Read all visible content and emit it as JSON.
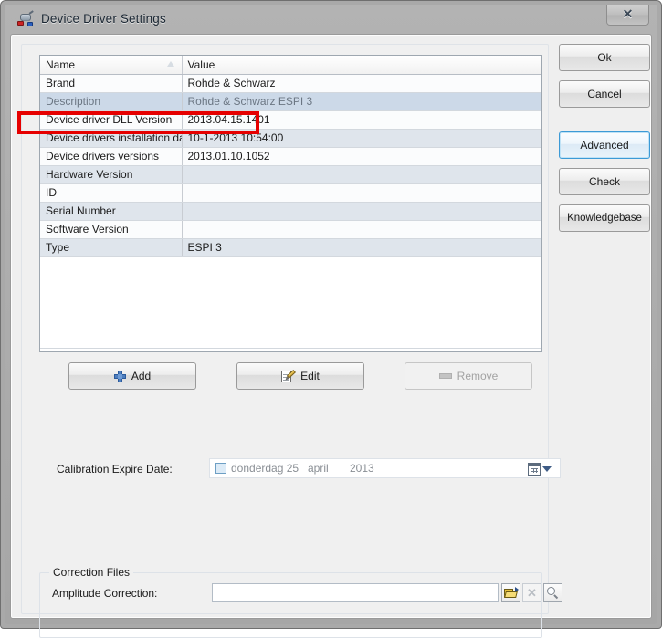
{
  "window": {
    "title": "Device Driver Settings",
    "title_icon": "device-driver-icon",
    "close_label": "✕"
  },
  "grid": {
    "columns": [
      "Name",
      "Value"
    ],
    "sort_indicator": "ascending",
    "rows": [
      {
        "name": "Brand",
        "value": "Rohde & Schwarz",
        "state": "normal"
      },
      {
        "name": "Description",
        "value": "Rohde & Schwarz ESPI 3",
        "state": "selected"
      },
      {
        "name": "Device driver DLL Version",
        "value": "2013.04.15.1401",
        "state": "normal"
      },
      {
        "name": "Device drivers installation date",
        "value": "10-1-2013 10:54:00",
        "state": "alt"
      },
      {
        "name": "Device drivers versions",
        "value": "2013.01.10.1052",
        "state": "normal"
      },
      {
        "name": "Hardware Version",
        "value": "",
        "state": "alt"
      },
      {
        "name": "ID",
        "value": "",
        "state": "normal"
      },
      {
        "name": "Serial Number",
        "value": "",
        "state": "alt"
      },
      {
        "name": "Software Version",
        "value": "",
        "state": "normal"
      },
      {
        "name": "Type",
        "value": "ESPI 3",
        "state": "alt"
      }
    ]
  },
  "row_buttons": {
    "add": "Add",
    "edit": "Edit",
    "remove": "Remove"
  },
  "calibration": {
    "label": "Calibration Expire Date:",
    "checked": false,
    "day": "donderdag 25",
    "month": "april",
    "year": "2013"
  },
  "correction": {
    "legend": "Correction Files",
    "amplitude_label": "Amplitude Correction:",
    "amplitude_value": "",
    "amplitude_placeholder": "",
    "browse_icon": "open-folder-icon",
    "clear_icon": "clear-x-icon",
    "search_icon": "magnifier-icon"
  },
  "side_buttons": {
    "ok": "Ok",
    "cancel": "Cancel",
    "advanced": "Advanced",
    "check": "Check",
    "knowledgebase": "Knowledgebase"
  },
  "annotation": {
    "color": "#e60000",
    "target_row": "Device driver DLL Version"
  }
}
